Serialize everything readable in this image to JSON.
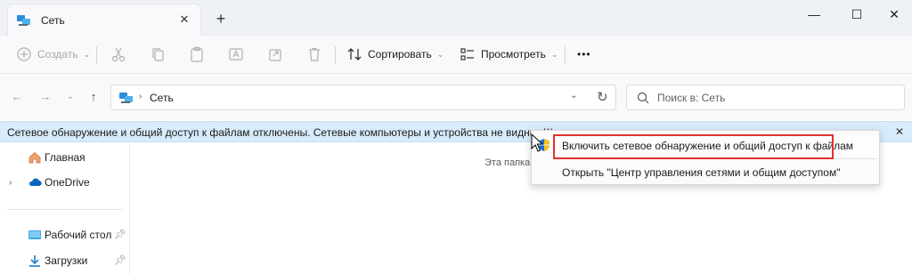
{
  "window": {
    "tab_title": "Сеть",
    "tab_close": "✕",
    "new_tab": "+",
    "minimize": "—",
    "maximize": "☐",
    "close": "✕"
  },
  "toolbar": {
    "create_label": "Создать",
    "sort_label": "Сортировать",
    "view_label": "Просмотреть",
    "more_label": "•••"
  },
  "address": {
    "breadcrumb": "Сеть",
    "search_placeholder": "Поиск в: Сеть"
  },
  "infobar": {
    "text": "Сетевое обнаружение и общий доступ к файлам отключены. Сетевые компьютеры и устройства не видны. Щелкните для изменения..."
  },
  "sidebar": {
    "items": [
      {
        "label": "Главная"
      },
      {
        "label": "OneDrive"
      },
      {
        "label": "Рабочий стол"
      },
      {
        "label": "Загрузки"
      }
    ]
  },
  "content": {
    "empty_text": "Эта папка"
  },
  "context_menu": {
    "items": [
      {
        "label": "Включить сетевое обнаружение и общий доступ к файлам"
      },
      {
        "label": "Открыть \"Центр управления сетями и общим доступом\""
      }
    ]
  },
  "colors": {
    "infobar_bg": "#d7ebfa",
    "highlight_outline": "#e0322b",
    "accent": "#0a64c2"
  },
  "icons": {
    "tab": "network-icon",
    "home": "home-icon",
    "onedrive": "cloud-icon",
    "desktop": "desktop-icon",
    "downloads": "download-icon",
    "shield": "uac-shield-icon"
  }
}
